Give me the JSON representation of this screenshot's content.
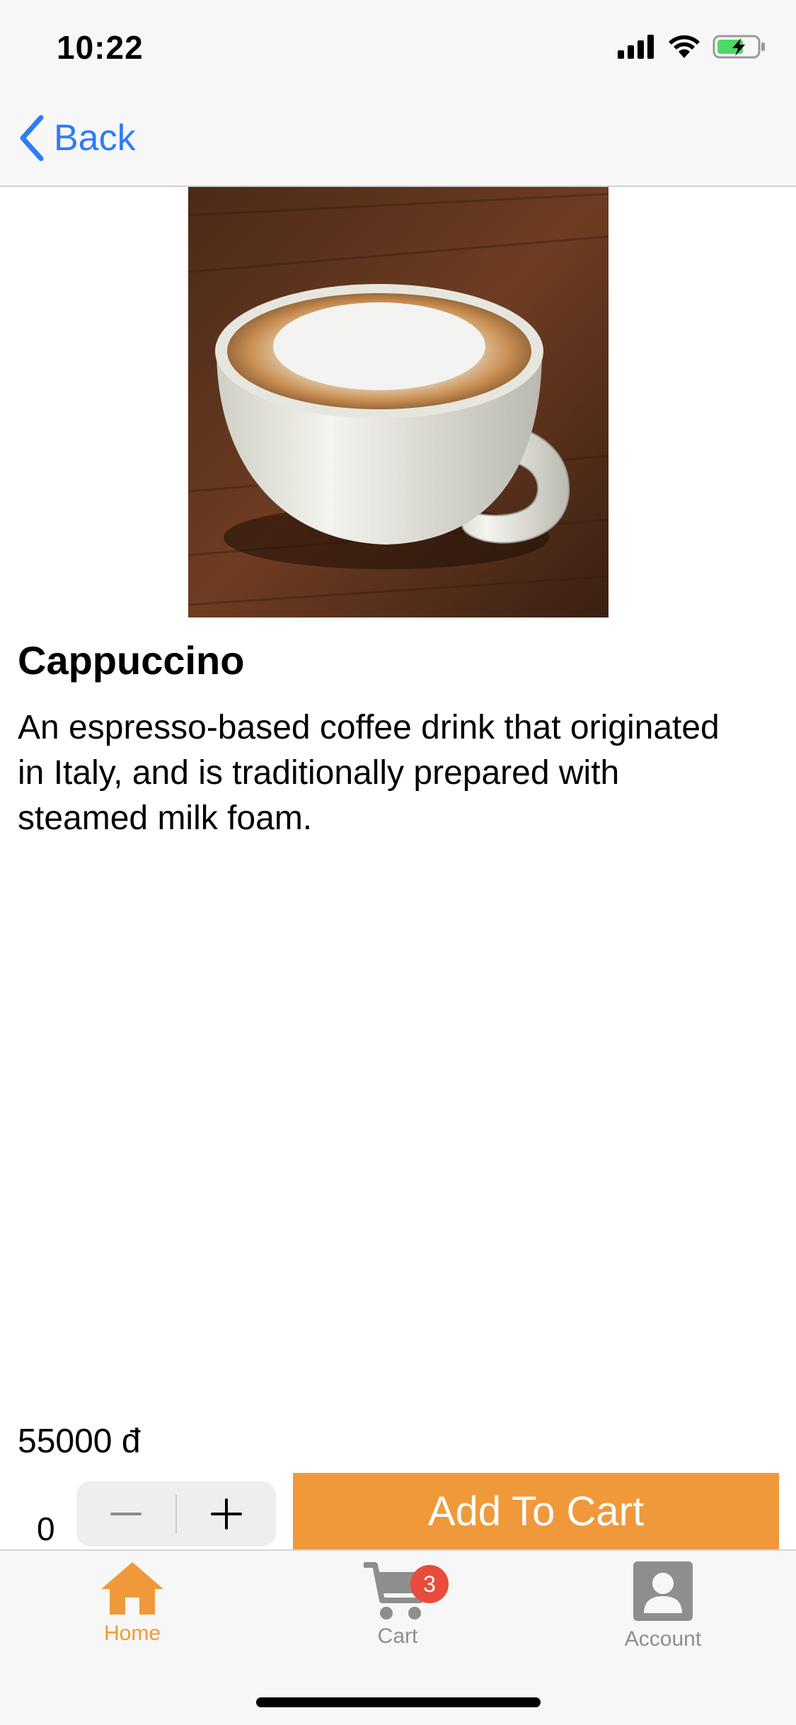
{
  "status_bar": {
    "time": "10:22"
  },
  "nav": {
    "back_label": "Back"
  },
  "product": {
    "name": "Cappuccino",
    "description": "An espresso-based coffee drink that originated in Italy, and is traditionally prepared with steamed milk foam.",
    "price": "55000 đ",
    "quantity": "0"
  },
  "actions": {
    "add_to_cart_label": "Add To Cart"
  },
  "tabs": [
    {
      "label": "Home",
      "icon": "home-icon",
      "active": true
    },
    {
      "label": "Cart",
      "icon": "cart-icon",
      "badge": "3"
    },
    {
      "label": "Account",
      "icon": "account-icon"
    }
  ],
  "colors": {
    "accent": "#f0993a",
    "link": "#2f7cf6",
    "badge": "#e94b3c",
    "inactive_tab": "#8e8e8e"
  }
}
